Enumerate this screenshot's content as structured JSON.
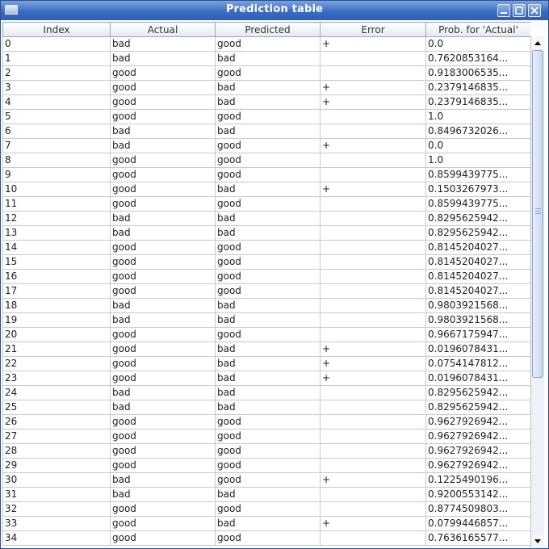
{
  "window": {
    "title": "Prediction table"
  },
  "table": {
    "columns": [
      "Index",
      "Actual",
      "Predicted",
      "Error",
      "Prob. for 'Actual'"
    ],
    "rows": [
      [
        "0",
        "bad",
        "good",
        "+",
        "0.0"
      ],
      [
        "1",
        "bad",
        "bad",
        "",
        "0.7620853164..."
      ],
      [
        "2",
        "good",
        "good",
        "",
        "0.9183006535..."
      ],
      [
        "3",
        "good",
        "bad",
        "+",
        "0.2379146835..."
      ],
      [
        "4",
        "good",
        "bad",
        "+",
        "0.2379146835..."
      ],
      [
        "5",
        "good",
        "good",
        "",
        "1.0"
      ],
      [
        "6",
        "bad",
        "bad",
        "",
        "0.8496732026..."
      ],
      [
        "7",
        "bad",
        "good",
        "+",
        "0.0"
      ],
      [
        "8",
        "good",
        "good",
        "",
        "1.0"
      ],
      [
        "9",
        "good",
        "good",
        "",
        "0.8599439775..."
      ],
      [
        "10",
        "good",
        "bad",
        "+",
        "0.1503267973..."
      ],
      [
        "11",
        "good",
        "good",
        "",
        "0.8599439775..."
      ],
      [
        "12",
        "bad",
        "bad",
        "",
        "0.8295625942..."
      ],
      [
        "13",
        "bad",
        "bad",
        "",
        "0.8295625942..."
      ],
      [
        "14",
        "good",
        "good",
        "",
        "0.8145204027..."
      ],
      [
        "15",
        "good",
        "good",
        "",
        "0.8145204027..."
      ],
      [
        "16",
        "good",
        "good",
        "",
        "0.8145204027..."
      ],
      [
        "17",
        "good",
        "good",
        "",
        "0.8145204027..."
      ],
      [
        "18",
        "bad",
        "bad",
        "",
        "0.9803921568..."
      ],
      [
        "19",
        "bad",
        "bad",
        "",
        "0.9803921568..."
      ],
      [
        "20",
        "good",
        "good",
        "",
        "0.9667175947..."
      ],
      [
        "21",
        "good",
        "bad",
        "+",
        "0.0196078431..."
      ],
      [
        "22",
        "good",
        "bad",
        "+",
        "0.0754147812..."
      ],
      [
        "23",
        "good",
        "bad",
        "+",
        "0.0196078431..."
      ],
      [
        "24",
        "bad",
        "bad",
        "",
        "0.8295625942..."
      ],
      [
        "25",
        "bad",
        "bad",
        "",
        "0.8295625942..."
      ],
      [
        "26",
        "good",
        "good",
        "",
        "0.9627926942..."
      ],
      [
        "27",
        "good",
        "good",
        "",
        "0.9627926942..."
      ],
      [
        "28",
        "good",
        "good",
        "",
        "0.9627926942..."
      ],
      [
        "29",
        "good",
        "good",
        "",
        "0.9627926942..."
      ],
      [
        "30",
        "bad",
        "good",
        "+",
        "0.1225490196..."
      ],
      [
        "31",
        "bad",
        "bad",
        "",
        "0.9200553142..."
      ],
      [
        "32",
        "good",
        "good",
        "",
        "0.8774509803..."
      ],
      [
        "33",
        "good",
        "bad",
        "+",
        "0.0799446857..."
      ],
      [
        "34",
        "good",
        "good",
        "",
        "0.7636165577..."
      ]
    ]
  },
  "scrollbar": {
    "position_fraction": 0.0
  },
  "icons": {
    "window": "window-icon",
    "minimize": "minimize-icon",
    "maximize": "maximize-icon",
    "close": "close-icon",
    "scroll_up": "arrow-up-icon",
    "scroll_down": "arrow-down-icon"
  },
  "colors": {
    "titlebar": "#3b6cc2",
    "grid_line": "#c9c9c9",
    "header_border": "#9aa7bd"
  }
}
